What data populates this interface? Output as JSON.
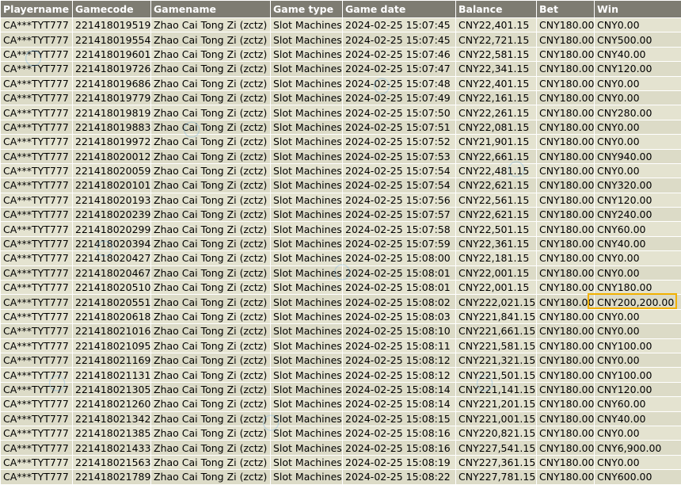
{
  "columns": [
    "Playername",
    "Gamecode",
    "Gamename",
    "Game type",
    "Game date",
    "Balance",
    "Bet",
    "Win"
  ],
  "rows": [
    [
      "CA***TYT777",
      "221418019519",
      "Zhao Cai Tong Zi (zctz)",
      "Slot Machines",
      "2024-02-25 15:07:45",
      "CNY22,401.15",
      "CNY180.00",
      "CNY0.00"
    ],
    [
      "CA***TYT777",
      "221418019554",
      "Zhao Cai Tong Zi (zctz)",
      "Slot Machines",
      "2024-02-25 15:07:45",
      "CNY22,721.15",
      "CNY180.00",
      "CNY500.00"
    ],
    [
      "CA***TYT777",
      "221418019601",
      "Zhao Cai Tong Zi (zctz)",
      "Slot Machines",
      "2024-02-25 15:07:46",
      "CNY22,581.15",
      "CNY180.00",
      "CNY40.00"
    ],
    [
      "CA***TYT777",
      "221418019726",
      "Zhao Cai Tong Zi (zctz)",
      "Slot Machines",
      "2024-02-25 15:07:47",
      "CNY22,341.15",
      "CNY180.00",
      "CNY120.00"
    ],
    [
      "CA***TYT777",
      "221418019686",
      "Zhao Cai Tong Zi (zctz)",
      "Slot Machines",
      "2024-02-25 15:07:48",
      "CNY22,401.15",
      "CNY180.00",
      "CNY0.00"
    ],
    [
      "CA***TYT777",
      "221418019779",
      "Zhao Cai Tong Zi (zctz)",
      "Slot Machines",
      "2024-02-25 15:07:49",
      "CNY22,161.15",
      "CNY180.00",
      "CNY0.00"
    ],
    [
      "CA***TYT777",
      "221418019819",
      "Zhao Cai Tong Zi (zctz)",
      "Slot Machines",
      "2024-02-25 15:07:50",
      "CNY22,261.15",
      "CNY180.00",
      "CNY280.00"
    ],
    [
      "CA***TYT777",
      "221418019883",
      "Zhao Cai Tong Zi (zctz)",
      "Slot Machines",
      "2024-02-25 15:07:51",
      "CNY22,081.15",
      "CNY180.00",
      "CNY0.00"
    ],
    [
      "CA***TYT777",
      "221418019972",
      "Zhao Cai Tong Zi (zctz)",
      "Slot Machines",
      "2024-02-25 15:07:52",
      "CNY21,901.15",
      "CNY180.00",
      "CNY0.00"
    ],
    [
      "CA***TYT777",
      "221418020012",
      "Zhao Cai Tong Zi (zctz)",
      "Slot Machines",
      "2024-02-25 15:07:53",
      "CNY22,661.15",
      "CNY180.00",
      "CNY940.00"
    ],
    [
      "CA***TYT777",
      "221418020059",
      "Zhao Cai Tong Zi (zctz)",
      "Slot Machines",
      "2024-02-25 15:07:54",
      "CNY22,481.15",
      "CNY180.00",
      "CNY0.00"
    ],
    [
      "CA***TYT777",
      "221418020101",
      "Zhao Cai Tong Zi (zctz)",
      "Slot Machines",
      "2024-02-25 15:07:54",
      "CNY22,621.15",
      "CNY180.00",
      "CNY320.00"
    ],
    [
      "CA***TYT777",
      "221418020193",
      "Zhao Cai Tong Zi (zctz)",
      "Slot Machines",
      "2024-02-25 15:07:56",
      "CNY22,561.15",
      "CNY180.00",
      "CNY120.00"
    ],
    [
      "CA***TYT777",
      "221418020239",
      "Zhao Cai Tong Zi (zctz)",
      "Slot Machines",
      "2024-02-25 15:07:57",
      "CNY22,621.15",
      "CNY180.00",
      "CNY240.00"
    ],
    [
      "CA***TYT777",
      "221418020299",
      "Zhao Cai Tong Zi (zctz)",
      "Slot Machines",
      "2024-02-25 15:07:58",
      "CNY22,501.15",
      "CNY180.00",
      "CNY60.00"
    ],
    [
      "CA***TYT777",
      "221418020394",
      "Zhao Cai Tong Zi (zctz)",
      "Slot Machines",
      "2024-02-25 15:07:59",
      "CNY22,361.15",
      "CNY180.00",
      "CNY40.00"
    ],
    [
      "CA***TYT777",
      "221418020427",
      "Zhao Cai Tong Zi (zctz)",
      "Slot Machines",
      "2024-02-25 15:08:00",
      "CNY22,181.15",
      "CNY180.00",
      "CNY0.00"
    ],
    [
      "CA***TYT777",
      "221418020467",
      "Zhao Cai Tong Zi (zctz)",
      "Slot Machines",
      "2024-02-25 15:08:01",
      "CNY22,001.15",
      "CNY180.00",
      "CNY0.00"
    ],
    [
      "CA***TYT777",
      "221418020510",
      "Zhao Cai Tong Zi (zctz)",
      "Slot Machines",
      "2024-02-25 15:08:01",
      "CNY22,001.15",
      "CNY180.00",
      "CNY180.00"
    ],
    [
      "CA***TYT777",
      "221418020551",
      "Zhao Cai Tong Zi (zctz)",
      "Slot Machines",
      "2024-02-25 15:08:02",
      "CNY222,021.15",
      "CNY180.00",
      "CNY200,200.00"
    ],
    [
      "CA***TYT777",
      "221418020618",
      "Zhao Cai Tong Zi (zctz)",
      "Slot Machines",
      "2024-02-25 15:08:03",
      "CNY221,841.15",
      "CNY180.00",
      "CNY0.00"
    ],
    [
      "CA***TYT777",
      "221418021016",
      "Zhao Cai Tong Zi (zctz)",
      "Slot Machines",
      "2024-02-25 15:08:10",
      "CNY221,661.15",
      "CNY180.00",
      "CNY0.00"
    ],
    [
      "CA***TYT777",
      "221418021095",
      "Zhao Cai Tong Zi (zctz)",
      "Slot Machines",
      "2024-02-25 15:08:11",
      "CNY221,581.15",
      "CNY180.00",
      "CNY100.00"
    ],
    [
      "CA***TYT777",
      "221418021169",
      "Zhao Cai Tong Zi (zctz)",
      "Slot Machines",
      "2024-02-25 15:08:12",
      "CNY221,321.15",
      "CNY180.00",
      "CNY0.00"
    ],
    [
      "CA***TYT777",
      "221418021131",
      "Zhao Cai Tong Zi (zctz)",
      "Slot Machines",
      "2024-02-25 15:08:12",
      "CNY221,501.15",
      "CNY180.00",
      "CNY100.00"
    ],
    [
      "CA***TYT777",
      "221418021305",
      "Zhao Cai Tong Zi (zctz)",
      "Slot Machines",
      "2024-02-25 15:08:14",
      "CNY221,141.15",
      "CNY180.00",
      "CNY120.00"
    ],
    [
      "CA***TYT777",
      "221418021260",
      "Zhao Cai Tong Zi (zctz)",
      "Slot Machines",
      "2024-02-25 15:08:14",
      "CNY221,201.15",
      "CNY180.00",
      "CNY60.00"
    ],
    [
      "CA***TYT777",
      "221418021342",
      "Zhao Cai Tong Zi (zctz)",
      "Slot Machines",
      "2024-02-25 15:08:15",
      "CNY221,001.15",
      "CNY180.00",
      "CNY40.00"
    ],
    [
      "CA***TYT777",
      "221418021385",
      "Zhao Cai Tong Zi (zctz)",
      "Slot Machines",
      "2024-02-25 15:08:16",
      "CNY220,821.15",
      "CNY180.00",
      "CNY0.00"
    ],
    [
      "CA***TYT777",
      "221418021433",
      "Zhao Cai Tong Zi (zctz)",
      "Slot Machines",
      "2024-02-25 15:08:16",
      "CNY227,541.15",
      "CNY180.00",
      "CNY6,900.00"
    ],
    [
      "CA***TYT777",
      "221418021563",
      "Zhao Cai Tong Zi (zctz)",
      "Slot Machines",
      "2024-02-25 15:08:19",
      "CNY227,361.15",
      "CNY180.00",
      "CNY0.00"
    ],
    [
      "CA***TYT777",
      "221418021789",
      "Zhao Cai Tong Zi (zctz)",
      "Slot Machines",
      "2024-02-25 15:08:22",
      "CNY227,781.15",
      "CNY180.00",
      "CNY600.00"
    ]
  ],
  "colors": {
    "header_bg": "#7e7c72",
    "row_bg": "#dcdbc7",
    "highlight_border": "#f2b100",
    "watermark": "#50a0e6"
  }
}
